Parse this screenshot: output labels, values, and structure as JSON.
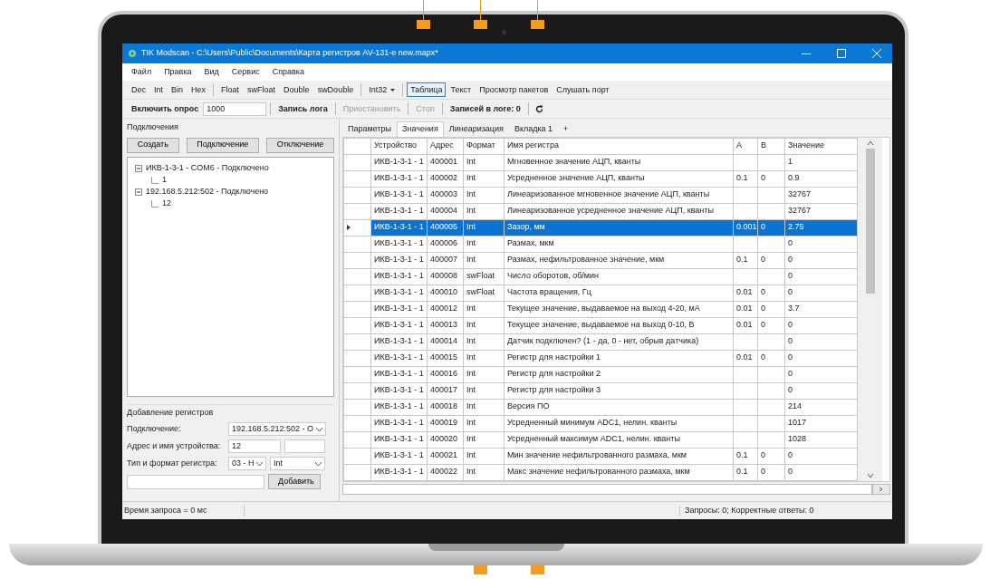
{
  "window": {
    "title": "TIK Modscan - C:\\Users\\Public\\Documents\\Карта регистров AV-131-e new.mapx*"
  },
  "menu": [
    "Файл",
    "Правка",
    "Вид",
    "Сервис",
    "Справка"
  ],
  "toolbar_format": [
    {
      "kind": "button",
      "label": "Dec",
      "selected": false
    },
    {
      "kind": "button",
      "label": "Int",
      "selected": false
    },
    {
      "kind": "button",
      "label": "Bin",
      "selected": false
    },
    {
      "kind": "button",
      "label": "Hex",
      "selected": false
    },
    {
      "kind": "separator"
    },
    {
      "kind": "button",
      "label": "Float",
      "selected": false
    },
    {
      "kind": "button",
      "label": "swFloat",
      "selected": false
    },
    {
      "kind": "button",
      "label": "Double",
      "selected": false
    },
    {
      "kind": "button",
      "label": "swDouble",
      "selected": false
    },
    {
      "kind": "separator"
    },
    {
      "kind": "dropdown",
      "label": "Int32"
    },
    {
      "kind": "separator"
    },
    {
      "kind": "button",
      "label": "Таблица",
      "selected": true
    },
    {
      "kind": "button",
      "label": "Текст",
      "selected": false
    },
    {
      "kind": "button",
      "label": "Просмотр пакетов",
      "selected": false
    },
    {
      "kind": "button",
      "label": "Слушать порт",
      "selected": false
    }
  ],
  "toolbar_poll": [
    {
      "kind": "button",
      "label": "Включить опрос",
      "disabled": false
    },
    {
      "kind": "input",
      "value": "1000"
    },
    {
      "kind": "separator"
    },
    {
      "kind": "button",
      "label": "Запись лога",
      "disabled": false
    },
    {
      "kind": "separator"
    },
    {
      "kind": "button",
      "label": "Приостановить",
      "disabled": true
    },
    {
      "kind": "separator"
    },
    {
      "kind": "button",
      "label": "Стоп",
      "disabled": true
    },
    {
      "kind": "separator"
    },
    {
      "kind": "text",
      "label": "Записей в логе: 0"
    },
    {
      "kind": "separator"
    },
    {
      "kind": "refresh"
    }
  ],
  "connections": {
    "title": "Подключения",
    "buttons": [
      "Создать",
      "Подключение",
      "Отключение"
    ],
    "tree": [
      {
        "label": "ИКВ-1-3-1 - COM6 - Подключено",
        "expanded": true,
        "children": [
          {
            "label": "1"
          }
        ]
      },
      {
        "label": "192.168.5.212:502 - Подключено",
        "expanded": true,
        "children": [
          {
            "label": "12"
          }
        ]
      }
    ]
  },
  "add_registers": {
    "title": "Добавление регистров",
    "connection_label": "Подключение:",
    "connection_value": "192.168.5.212:502 - О",
    "address_label": "Адрес и имя устройства:",
    "address_value": "12",
    "type_label": "Тип и формат регистра:",
    "type_value": "03 - H",
    "format_value": "Int",
    "add_button": "Добавить"
  },
  "tabs": [
    {
      "label": "Параметры",
      "selected": false
    },
    {
      "label": "Значения",
      "selected": true
    },
    {
      "label": "Линеаризация",
      "selected": false
    },
    {
      "label": "Вкладка 1",
      "selected": false
    },
    {
      "label": "+",
      "selected": false
    }
  ],
  "table": {
    "columns": [
      "Устройство",
      "Адрес",
      "Формат",
      "Имя регистра",
      "A",
      "B",
      "Значение"
    ],
    "rows": [
      {
        "selected": false,
        "cells": [
          "ИКВ-1-3-1 - 1",
          "400001",
          "Int",
          "Мгновенное значение АЦП, кванты",
          "",
          "",
          "1"
        ]
      },
      {
        "selected": false,
        "cells": [
          "ИКВ-1-3-1 - 1",
          "400002",
          "Int",
          "Усредненное значение АЦП, кванты",
          "0.1",
          "0",
          "0.9"
        ]
      },
      {
        "selected": false,
        "cells": [
          "ИКВ-1-3-1 - 1",
          "400003",
          "Int",
          "Линеаризованное мгновенное значение АЦП, кванты",
          "",
          "",
          "32767"
        ]
      },
      {
        "selected": false,
        "cells": [
          "ИКВ-1-3-1 - 1",
          "400004",
          "Int",
          "Линеаризованное усредненное значение АЦП, кванты",
          "",
          "",
          "32767"
        ]
      },
      {
        "selected": true,
        "cells": [
          "ИКВ-1-3-1 - 1",
          "400005",
          "Int",
          "Зазор, мм",
          "0.001",
          "0",
          "2.75"
        ]
      },
      {
        "selected": false,
        "cells": [
          "ИКВ-1-3-1 - 1",
          "400006",
          "Int",
          "Размах, мкм",
          "",
          "",
          "0"
        ]
      },
      {
        "selected": false,
        "cells": [
          "ИКВ-1-3-1 - 1",
          "400007",
          "Int",
          "Размах, нефильтрованное значение, мкм",
          "0.1",
          "0",
          "0"
        ]
      },
      {
        "selected": false,
        "cells": [
          "ИКВ-1-3-1 - 1",
          "400008",
          "swFloat",
          "Число оборотов, об/мин",
          "",
          "",
          "0"
        ]
      },
      {
        "selected": false,
        "cells": [
          "ИКВ-1-3-1 - 1",
          "400010",
          "swFloat",
          "Частота вращения, Гц",
          "0.01",
          "0",
          "0"
        ]
      },
      {
        "selected": false,
        "cells": [
          "ИКВ-1-3-1 - 1",
          "400012",
          "Int",
          "Текущее значение, выдаваемое на выход 4-20, мА",
          "0.01",
          "0",
          "3.7"
        ]
      },
      {
        "selected": false,
        "cells": [
          "ИКВ-1-3-1 - 1",
          "400013",
          "Int",
          "Текущее значение, выдаваемое на выход 0-10, В",
          "0.01",
          "0",
          "0"
        ]
      },
      {
        "selected": false,
        "cells": [
          "ИКВ-1-3-1 - 1",
          "400014",
          "Int",
          "Датчик подключен? (1 - да, 0 - нет, обрыв датчика)",
          "",
          "",
          "0"
        ]
      },
      {
        "selected": false,
        "cells": [
          "ИКВ-1-3-1 - 1",
          "400015",
          "Int",
          "Регистр для настройки 1",
          "0.01",
          "0",
          "0"
        ]
      },
      {
        "selected": false,
        "cells": [
          "ИКВ-1-3-1 - 1",
          "400016",
          "Int",
          "Регистр для настройки 2",
          "",
          "",
          "0"
        ]
      },
      {
        "selected": false,
        "cells": [
          "ИКВ-1-3-1 - 1",
          "400017",
          "Int",
          "Регистр для настройки 3",
          "",
          "",
          "0"
        ]
      },
      {
        "selected": false,
        "cells": [
          "ИКВ-1-3-1 - 1",
          "400018",
          "Int",
          "Версия ПО",
          "",
          "",
          "214"
        ]
      },
      {
        "selected": false,
        "cells": [
          "ИКВ-1-3-1 - 1",
          "400019",
          "Int",
          "Усредненный минимум ADC1, нелин. кванты",
          "",
          "",
          "1017"
        ]
      },
      {
        "selected": false,
        "cells": [
          "ИКВ-1-3-1 - 1",
          "400020",
          "Int",
          "Усредненный максимум ADC1, нелин. кванты",
          "",
          "",
          "1028"
        ]
      },
      {
        "selected": false,
        "cells": [
          "ИКВ-1-3-1 - 1",
          "400021",
          "Int",
          "Мин значение нефильтрованного размаха, мкм",
          "0.1",
          "0",
          "0"
        ]
      },
      {
        "selected": false,
        "cells": [
          "ИКВ-1-3-1 - 1",
          "400022",
          "Int",
          "Макс значение нефильтрованного размаха, мкм",
          "0.1",
          "0",
          "0"
        ]
      }
    ]
  },
  "status_bar": {
    "left": "Время запроса = 0 мс",
    "right": "Запросы: 0; Корректные ответы: 0"
  }
}
